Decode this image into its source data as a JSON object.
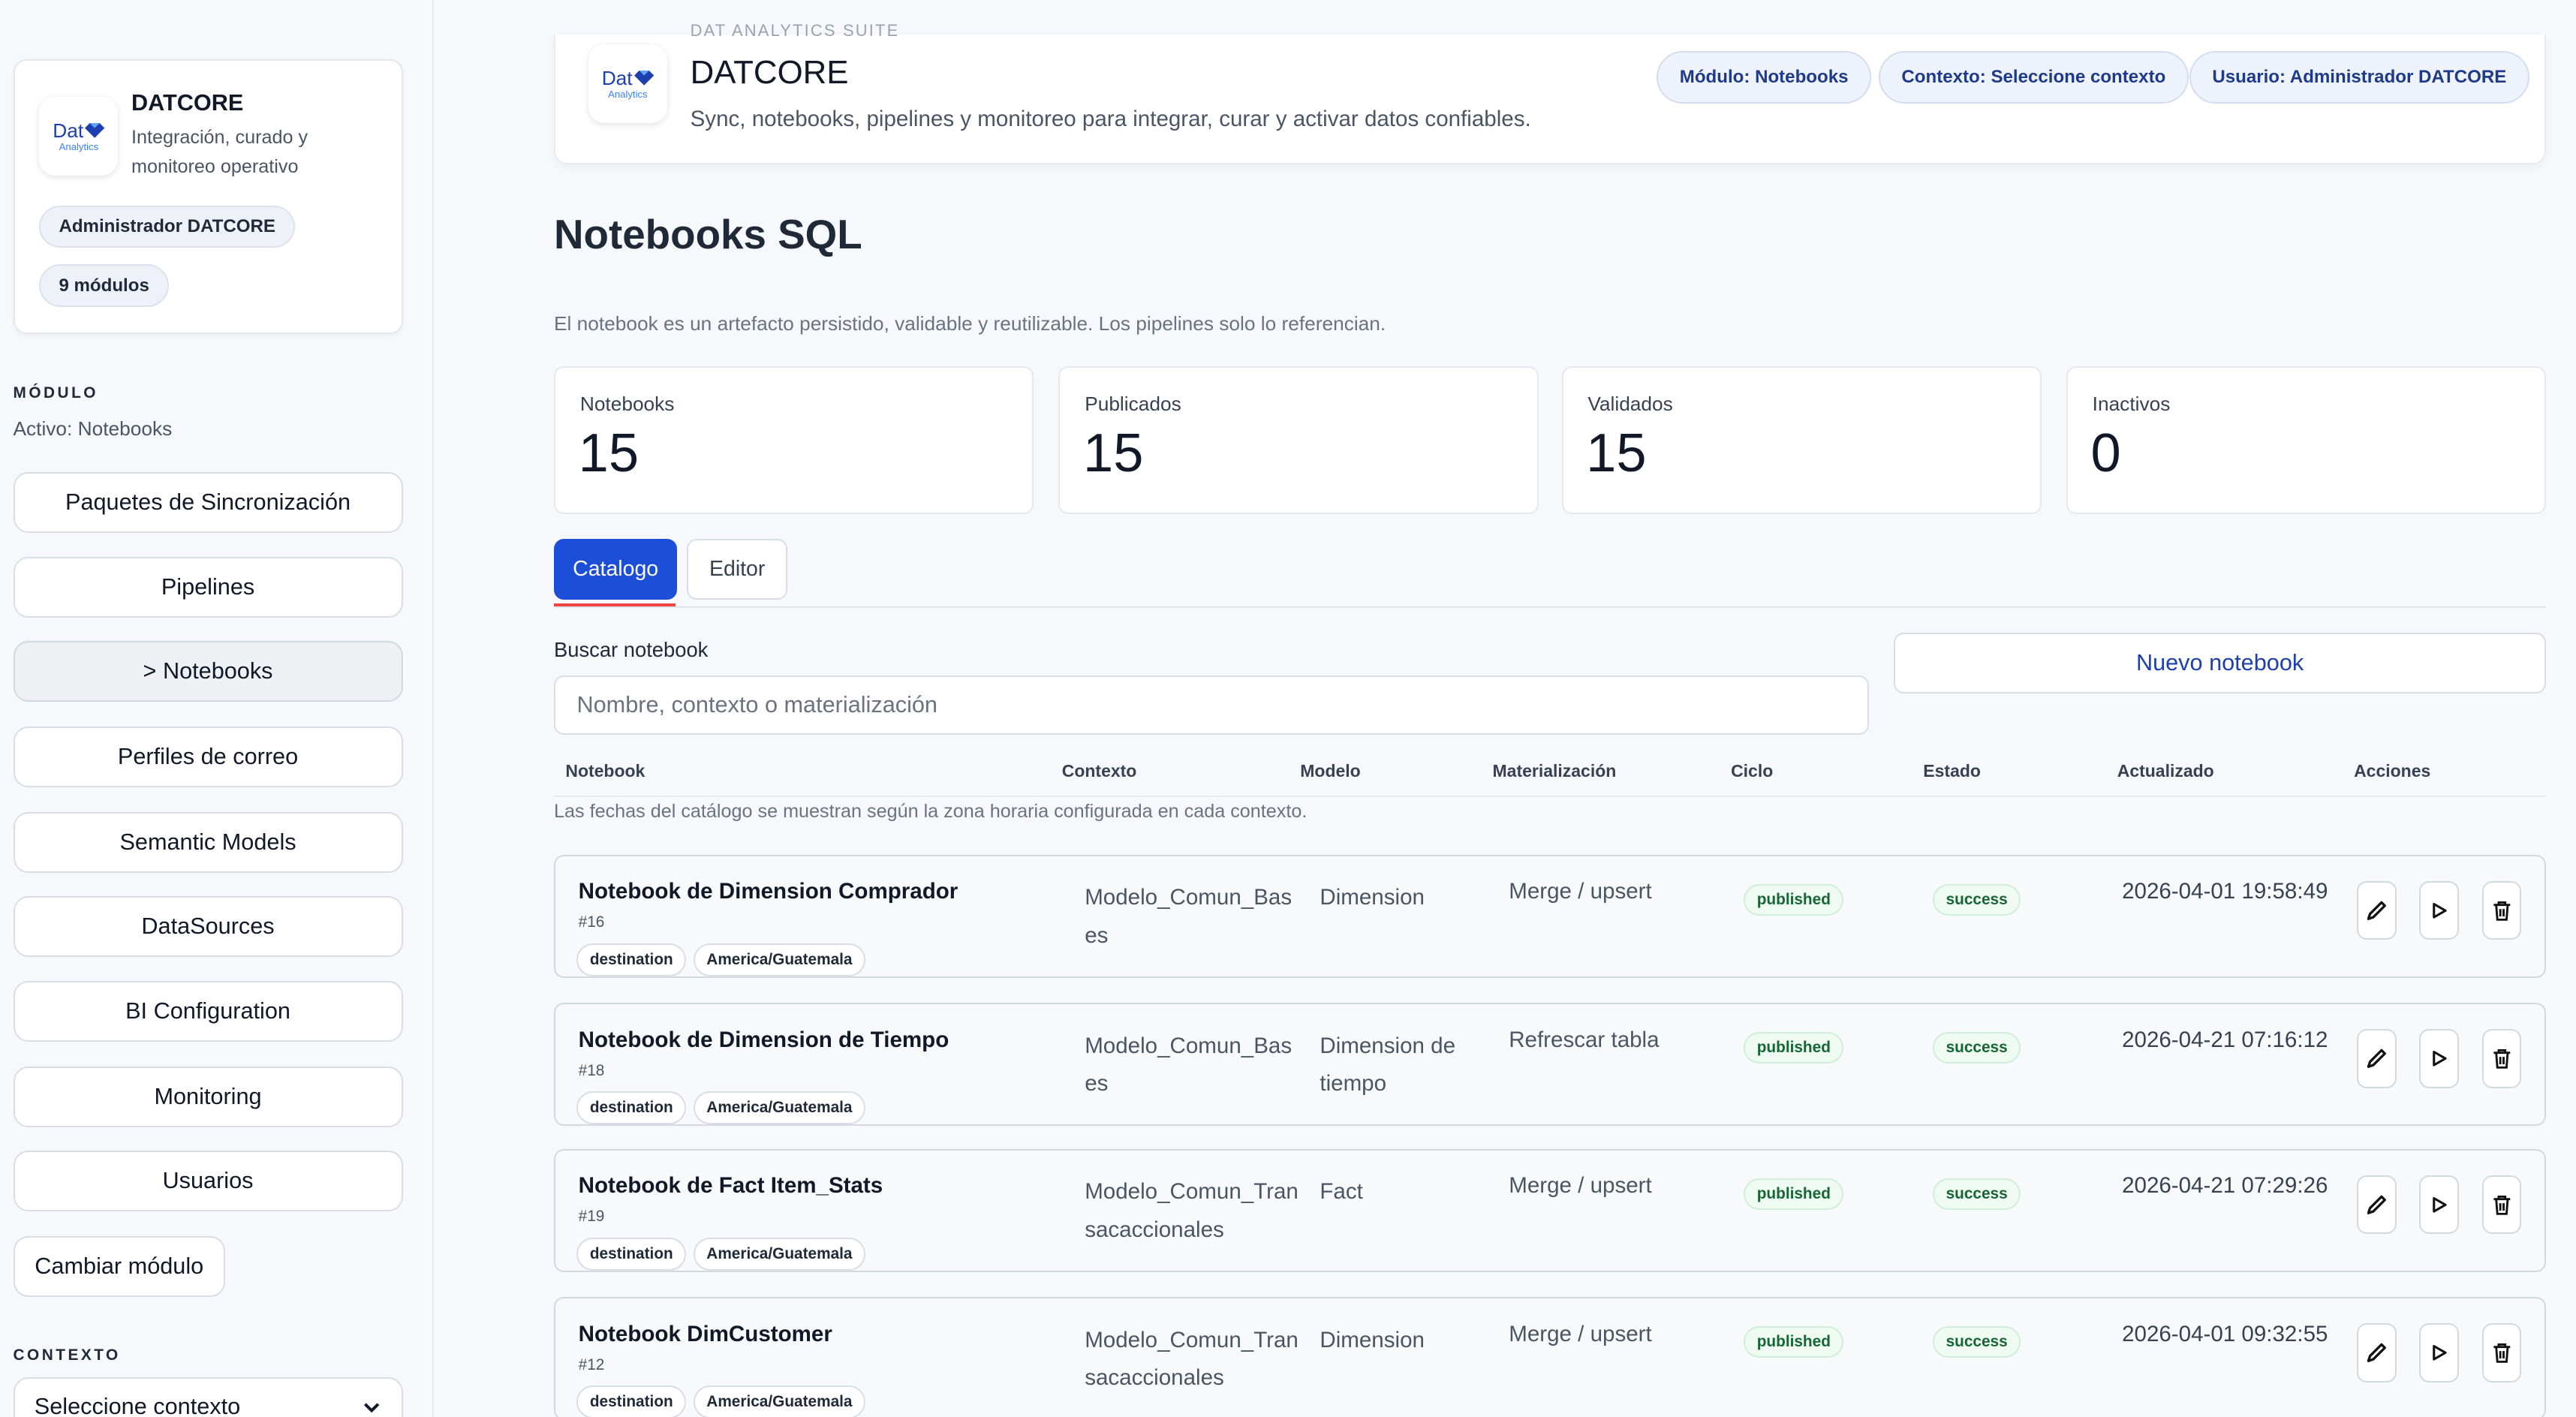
{
  "brand": {
    "name": "DATCORE",
    "description": "Integración, curado y monitoreo operativo",
    "logo_text": "Dat",
    "logo_sub": "Analytics",
    "role_pill": "Administrador DATCORE",
    "modules_pill": "9 módulos"
  },
  "sidebar": {
    "module_section": "MÓDULO",
    "active_text": "Activo: Notebooks",
    "items": [
      {
        "label": "Paquetes de Sincronización"
      },
      {
        "label": "Pipelines"
      },
      {
        "label": "> Notebooks"
      },
      {
        "label": "Perfiles de correo"
      },
      {
        "label": "Semantic Models"
      },
      {
        "label": "DataSources"
      },
      {
        "label": "BI Configuration"
      },
      {
        "label": "Monitoring"
      },
      {
        "label": "Usuarios"
      }
    ],
    "change_module": "Cambiar módulo",
    "context_section": "CONTEXTO",
    "context_select": "Seleccione contexto"
  },
  "header": {
    "faded_text": "DAT ANALYTICS SUITE",
    "title": "DATCORE",
    "subtitle": "Sync, notebooks, pipelines y monitoreo para integrar, curar y activar datos confiables.",
    "pill_module": "Módulo: Notebooks",
    "pill_context": "Contexto: Seleccione contexto",
    "pill_user": "Usuario: Administrador DATCORE"
  },
  "page": {
    "title": "Notebooks SQL",
    "description": "El notebook es un artefacto persistido, validable y reutilizable. Los pipelines solo lo referencian."
  },
  "stats": [
    {
      "label": "Notebooks",
      "value": "15"
    },
    {
      "label": "Publicados",
      "value": "15"
    },
    {
      "label": "Validados",
      "value": "15"
    },
    {
      "label": "Inactivos",
      "value": "0"
    }
  ],
  "tabs": {
    "catalog": "Catalogo",
    "editor": "Editor"
  },
  "search": {
    "label": "Buscar notebook",
    "placeholder": "Nombre, contexto o materialización",
    "new_button": "Nuevo notebook"
  },
  "table": {
    "headers": [
      "Notebook",
      "Contexto",
      "Modelo",
      "Materialización",
      "Ciclo",
      "Estado",
      "Actualizado",
      "Acciones"
    ],
    "note": "Las fechas del catálogo se muestran según la zona horaria configurada en cada contexto.",
    "rows": [
      {
        "name": "Notebook de Dimension Comprador",
        "id": "#16",
        "tag1": "destination",
        "tag2": "America/Guatemala",
        "context": "Modelo_Comun_Bases",
        "model": "Dimension",
        "materialization": "Merge / upsert",
        "cycle": "published",
        "status": "success",
        "updated": "2026-04-01 19:58:49"
      },
      {
        "name": "Notebook de Dimension de Tiempo",
        "id": "#18",
        "tag1": "destination",
        "tag2": "America/Guatemala",
        "context": "Modelo_Comun_Bases",
        "model": "Dimension de tiempo",
        "materialization": "Refrescar tabla",
        "cycle": "published",
        "status": "success",
        "updated": "2026-04-21 07:16:12"
      },
      {
        "name": "Notebook de Fact Item_Stats",
        "id": "#19",
        "tag1": "destination",
        "tag2": "America/Guatemala",
        "context": "Modelo_Comun_Transacaccionales",
        "model": "Fact",
        "materialization": "Merge / upsert",
        "cycle": "published",
        "status": "success",
        "updated": "2026-04-21 07:29:26"
      },
      {
        "name": "Notebook DimCustomer",
        "id": "#12",
        "tag1": "destination",
        "tag2": "America/Guatemala",
        "context": "Modelo_Comun_Transacaccionales",
        "model": "Dimension",
        "materialization": "Merge / upsert",
        "cycle": "published",
        "status": "success",
        "updated": "2026-04-01 09:32:55"
      }
    ]
  },
  "colors": {
    "accent": "#1d4ed8",
    "tab_underline": "#ef4444",
    "success_text": "#166534"
  }
}
